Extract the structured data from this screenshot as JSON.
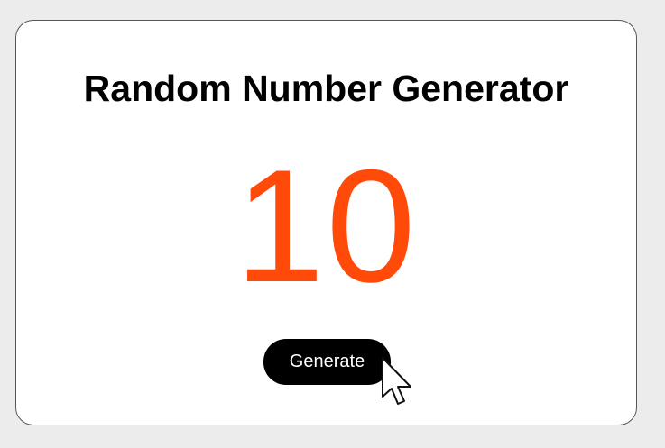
{
  "app": {
    "title": "Random Number Generator",
    "current_number": "10",
    "generate_label": "Generate"
  },
  "colors": {
    "background": "#ececec",
    "card": "#ffffff",
    "number": "#ff4a0a",
    "button": "#000000",
    "button_text": "#ffffff"
  },
  "icons": {
    "cursor": "mouse-pointer-icon"
  }
}
